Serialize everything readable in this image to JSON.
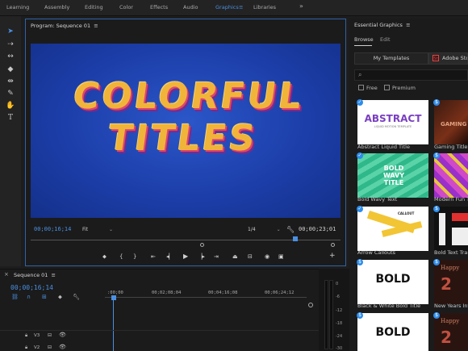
{
  "workspaces": {
    "items": [
      "Learning",
      "Assembly",
      "Editing",
      "Color",
      "Effects",
      "Audio",
      "Graphics",
      "Libraries"
    ],
    "active": "Graphics",
    "more": "»"
  },
  "program": {
    "title": "Program: Sequence 01",
    "menu_icon": "≡",
    "viewer_text": "COLORFUL\nTITLES",
    "timecode_current": "00;00;16;14",
    "fit": "Fit",
    "resolution": "1/4",
    "timecode_duration": "00;00;23;01"
  },
  "essential_graphics": {
    "title": "Essential Graphics",
    "menu_icon": "≡",
    "tabs": [
      "Browse",
      "Edit"
    ],
    "my_templates": "My Templates",
    "adobe_stock": "Adobe Stock",
    "stock_badge": "St",
    "filter_free": "Free",
    "filter_premium": "Premium",
    "templates": [
      {
        "label": "Abstract Liquid Title",
        "thumb_text": "ABSTRACT",
        "thumb_sub": "LIQUID MOTION TEMPLATE"
      },
      {
        "label": "Gaming Title",
        "thumb_text": "GAMING"
      },
      {
        "label": "Bold Wavy Text",
        "thumb_text": "BOLD WAVY TITLE"
      },
      {
        "label": "Modern Fun Tr"
      },
      {
        "label": "Arrow Callouts",
        "thumb_text": "CALLOUT"
      },
      {
        "label": "Bold Text Transi"
      },
      {
        "label": "Black & White Bold Title",
        "thumb_text": "BOLD"
      },
      {
        "label": "New Years Intro",
        "thumb_text": "Happy"
      },
      {
        "label": "",
        "thumb_text": "BOLD"
      },
      {
        "label": "",
        "thumb_text": "Happy"
      }
    ]
  },
  "timeline": {
    "title": "Sequence 01",
    "menu_icon": "≡",
    "timecode": "00;00;16;14",
    "ruler": [
      ":00;00",
      "00;02;08;04",
      "00;04;16;08",
      "00;06;24;12"
    ],
    "tracks": [
      "V3",
      "V2"
    ]
  },
  "audio_meter": {
    "db_labels": [
      "0",
      "-6",
      "-12",
      "-18",
      "-24",
      "-30"
    ]
  },
  "colors": {
    "accent": "#4a90e2",
    "panel_bg": "#1b1b1b",
    "title_yellow": "#f0b43a",
    "viewer_blue": "#1c3ea9"
  }
}
